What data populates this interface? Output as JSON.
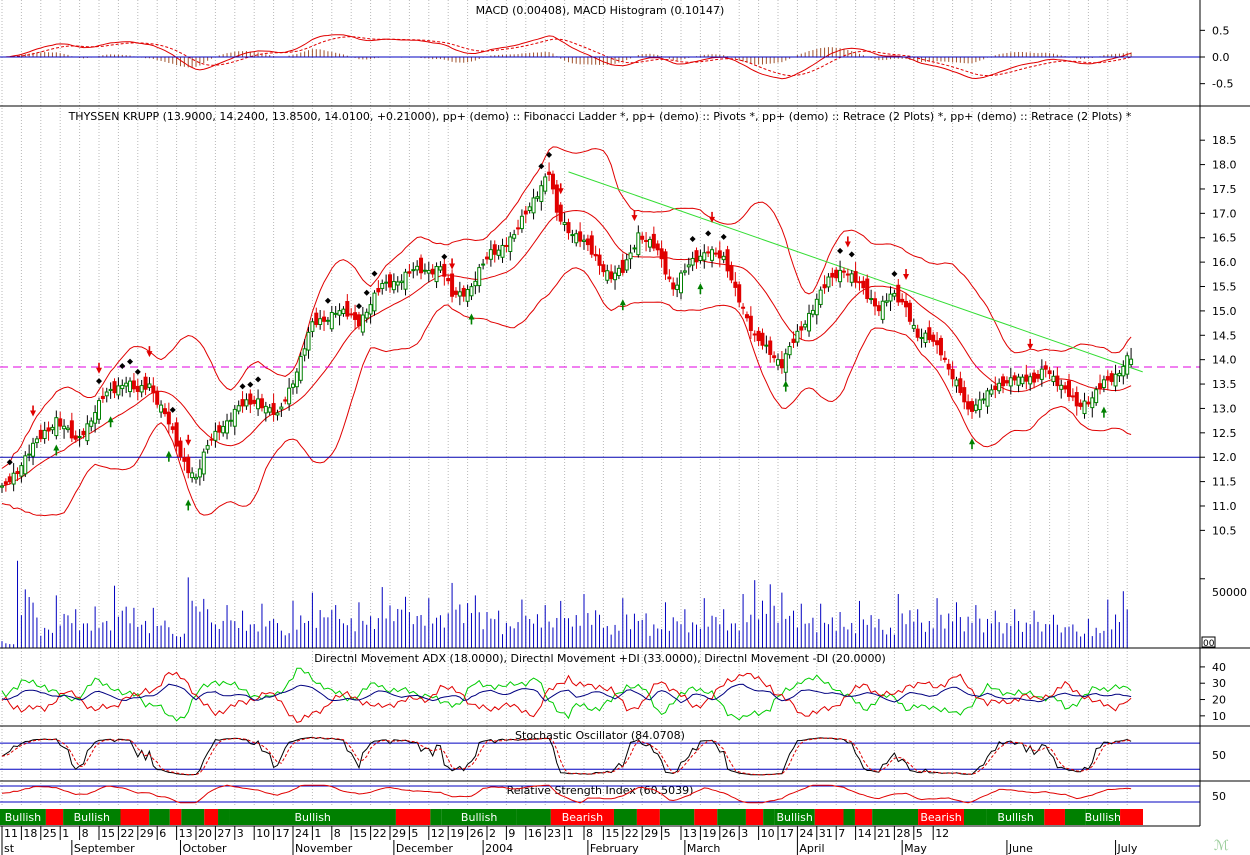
{
  "panels": {
    "macd": {
      "title": "MACD (0.00408), MACD Histogram (0.10147)",
      "ticks": [
        "0.5",
        "0.0",
        "-0.5"
      ]
    },
    "price": {
      "title": "THYSSEN KRUPP (13.9000, 14.2400, 13.8500, 14.0100, +0.21000), pp+ (demo) :: Fibonacci Ladder *, pp+ (demo) :: Pivots *, pp+ (demo) :: Retrace (2 Plots) *, pp+ (demo) :: Retrace (2 Plots) *",
      "ticks": [
        "18.5",
        "18.0",
        "17.5",
        "17.0",
        "16.5",
        "16.0",
        "15.5",
        "15.0",
        "14.5",
        "14.0",
        "13.5",
        "13.0",
        "12.5",
        "12.0",
        "11.5",
        "11.0",
        "10.5"
      ]
    },
    "volume": {
      "ticks": [
        "50000"
      ],
      "corner_label": "00"
    },
    "adx": {
      "title": "Directnl Movement ADX (18.0000), Directnl Movement +DI (33.0000), Directnl Movement -DI (20.0000)",
      "ticks": [
        "40",
        "30",
        "20",
        "10"
      ]
    },
    "stochastic": {
      "title": "Stochastic Oscillator (84.0708)",
      "ticks": [
        "50"
      ]
    },
    "rsi": {
      "title": "Relative Strength Index (60.5039)",
      "ticks": [
        "50"
      ]
    }
  },
  "signals": [
    {
      "label": "Bullish",
      "state": "bull"
    },
    {
      "label": "",
      "state": "bear"
    },
    {
      "label": "Bullish",
      "state": "bull"
    },
    {
      "label": "",
      "state": "bear"
    },
    {
      "label": "",
      "state": "bull"
    },
    {
      "label": "",
      "state": "bear"
    },
    {
      "label": "",
      "state": "bull"
    },
    {
      "label": "",
      "state": "bear"
    },
    {
      "label": "",
      "state": "bull"
    },
    {
      "label": "Bullish",
      "state": "bull"
    },
    {
      "label": "",
      "state": "bear"
    },
    {
      "label": "",
      "state": "bull"
    },
    {
      "label": "Bullish",
      "state": "bull"
    },
    {
      "label": "",
      "state": "bull"
    },
    {
      "label": "Bearish",
      "state": "bear"
    },
    {
      "label": "",
      "state": "bull"
    },
    {
      "label": "",
      "state": "bear"
    },
    {
      "label": "",
      "state": "bull"
    },
    {
      "label": "",
      "state": "bear"
    },
    {
      "label": "",
      "state": "bull"
    },
    {
      "label": "",
      "state": "bear"
    },
    {
      "label": "",
      "state": "bull"
    },
    {
      "label": "Bullish",
      "state": "bull"
    },
    {
      "label": "",
      "state": "bear"
    },
    {
      "label": "",
      "state": "bull"
    },
    {
      "label": "",
      "state": "bear"
    },
    {
      "label": "",
      "state": "bull"
    },
    {
      "label": "Bearish",
      "state": "bear"
    },
    {
      "label": "",
      "state": "bull"
    },
    {
      "label": "Bullish",
      "state": "bull"
    },
    {
      "label": "",
      "state": "bear"
    },
    {
      "label": "",
      "state": "bull"
    },
    {
      "label": "Bullish",
      "state": "bull"
    },
    {
      "label": "",
      "state": "bear"
    }
  ],
  "x_axis": {
    "days": [
      "11",
      "18",
      "25",
      "1",
      "8",
      "15",
      "22",
      "29",
      "6",
      "13",
      "20",
      "27",
      "3",
      "10",
      "17",
      "24",
      "1",
      "8",
      "15",
      "22",
      "29",
      "5",
      "12",
      "19",
      "26",
      "2",
      "9",
      "16",
      "23",
      "1",
      "8",
      "15",
      "22",
      "29",
      "5",
      "13",
      "19",
      "26",
      "3",
      "10",
      "17",
      "24",
      "31",
      "7",
      "14",
      "21",
      "28",
      "5",
      "12"
    ],
    "months": [
      "st",
      "September",
      "October",
      "November",
      "December",
      "2004",
      "February",
      "March",
      "April",
      "May",
      "June",
      "July"
    ]
  },
  "chart_data": {
    "type": "candlestick",
    "title": "THYSSEN KRUPP (13.9000, 14.2400, 13.8500, 14.0100, +0.21000)",
    "last_bar": {
      "open": 13.9,
      "high": 14.24,
      "low": 13.85,
      "close": 14.01,
      "change": 0.21
    },
    "close_path": [
      [
        0,
        11.3
      ],
      [
        6,
        12.0
      ],
      [
        14,
        12.8
      ],
      [
        19,
        12.3
      ],
      [
        26,
        13.2
      ],
      [
        32,
        13.6
      ],
      [
        35,
        13.3
      ],
      [
        38,
        13.5
      ],
      [
        42,
        12.9
      ],
      [
        46,
        12.0
      ],
      [
        50,
        11.6
      ],
      [
        53,
        12.2
      ],
      [
        56,
        12.6
      ],
      [
        61,
        13.0
      ],
      [
        66,
        13.2
      ],
      [
        71,
        12.8
      ],
      [
        76,
        13.8
      ],
      [
        80,
        14.7
      ],
      [
        86,
        15.0
      ],
      [
        92,
        14.8
      ],
      [
        98,
        15.5
      ],
      [
        106,
        15.8
      ],
      [
        113,
        15.9
      ],
      [
        116,
        15.3
      ],
      [
        121,
        15.5
      ],
      [
        126,
        16.2
      ],
      [
        132,
        16.5
      ],
      [
        136,
        17.2
      ],
      [
        141,
        17.8
      ],
      [
        143,
        17.0
      ],
      [
        146,
        16.7
      ],
      [
        152,
        16.2
      ],
      [
        157,
        15.7
      ],
      [
        160,
        15.8
      ],
      [
        164,
        16.6
      ],
      [
        169,
        16.2
      ],
      [
        173,
        15.5
      ],
      [
        177,
        15.9
      ],
      [
        182,
        16.3
      ],
      [
        186,
        16.0
      ],
      [
        190,
        15.3
      ],
      [
        194,
        14.4
      ],
      [
        198,
        14.2
      ],
      [
        201,
        13.9
      ],
      [
        205,
        14.5
      ],
      [
        209,
        15.1
      ],
      [
        213,
        15.6
      ],
      [
        217,
        15.9
      ],
      [
        220,
        15.6
      ],
      [
        223,
        15.3
      ],
      [
        226,
        15.1
      ],
      [
        229,
        15.3
      ],
      [
        233,
        15.1
      ],
      [
        236,
        14.5
      ],
      [
        239,
        14.4
      ],
      [
        242,
        14.2
      ],
      [
        246,
        13.5
      ],
      [
        249,
        12.9
      ],
      [
        253,
        13.3
      ],
      [
        257,
        13.4
      ],
      [
        261,
        13.7
      ],
      [
        266,
        13.5
      ],
      [
        269,
        13.9
      ],
      [
        273,
        13.4
      ],
      [
        277,
        13.1
      ],
      [
        281,
        13.2
      ],
      [
        284,
        13.5
      ],
      [
        287,
        13.7
      ],
      [
        290,
        14.01
      ]
    ],
    "volume_bars": [
      [
        0,
        5000
      ],
      [
        4,
        63000
      ],
      [
        9,
        22000
      ],
      [
        14,
        38000
      ],
      [
        19,
        28000
      ],
      [
        24,
        30000
      ],
      [
        29,
        45000
      ],
      [
        34,
        29000
      ],
      [
        39,
        29000
      ],
      [
        43,
        15000
      ],
      [
        48,
        51000
      ],
      [
        53,
        28000
      ],
      [
        58,
        31000
      ],
      [
        62,
        27000
      ],
      [
        67,
        32000
      ],
      [
        71,
        18000
      ],
      [
        75,
        34000
      ],
      [
        80,
        40000
      ],
      [
        86,
        31000
      ],
      [
        92,
        33000
      ],
      [
        98,
        44000
      ],
      [
        104,
        37000
      ],
      [
        110,
        36000
      ],
      [
        116,
        47000
      ],
      [
        122,
        38000
      ],
      [
        128,
        27000
      ],
      [
        134,
        35000
      ],
      [
        140,
        31000
      ],
      [
        144,
        34000
      ],
      [
        150,
        39000
      ],
      [
        154,
        24000
      ],
      [
        160,
        36000
      ],
      [
        166,
        25000
      ],
      [
        171,
        33000
      ],
      [
        176,
        28000
      ],
      [
        181,
        36000
      ],
      [
        186,
        28000
      ],
      [
        191,
        39000
      ],
      [
        194,
        49000
      ],
      [
        198,
        46000
      ],
      [
        201,
        40000
      ],
      [
        206,
        32000
      ],
      [
        211,
        32000
      ],
      [
        216,
        26000
      ],
      [
        221,
        34000
      ],
      [
        226,
        21000
      ],
      [
        231,
        39000
      ],
      [
        236,
        28000
      ],
      [
        241,
        36000
      ],
      [
        246,
        33000
      ],
      [
        251,
        31000
      ],
      [
        256,
        27000
      ],
      [
        261,
        28000
      ],
      [
        266,
        27000
      ],
      [
        271,
        24000
      ],
      [
        276,
        17000
      ],
      [
        280,
        21000
      ],
      [
        285,
        35000
      ],
      [
        289,
        41000
      ]
    ],
    "volume_ticks": [
      50000
    ],
    "ylim": [
      10.2,
      18.75
    ],
    "bars_total": 291,
    "horizontal_levels": [
      {
        "value": 13.85,
        "style": "dashed",
        "color": "#e000e0"
      },
      {
        "value": 12.0,
        "style": "solid",
        "color": "#0000b0"
      }
    ],
    "trendline": {
      "from": [
        146,
        17.85
      ],
      "to": [
        294,
        13.75
      ],
      "color": "#33dd33"
    },
    "indicators": {
      "macd_last": 0.00408,
      "macd_hist_last": 0.10147,
      "macd_ylim": [
        -0.7,
        0.75
      ],
      "adx_last": 18.0,
      "plus_di_last": 33.0,
      "minus_di_last": 20.0,
      "adx_ylim": [
        5,
        43
      ],
      "stochastic_last": 84.0708,
      "stochastic_ylim": [
        0,
        110
      ],
      "rsi_last": 60.5039,
      "rsi_ylim": [
        20,
        80
      ]
    },
    "colors": {
      "up": "#008000",
      "down": "#e00000",
      "volume": "#0000c0",
      "bands": "#e00000",
      "adx": "#000080",
      "plus_di": "#00cc00",
      "minus_di": "#e00000"
    }
  }
}
